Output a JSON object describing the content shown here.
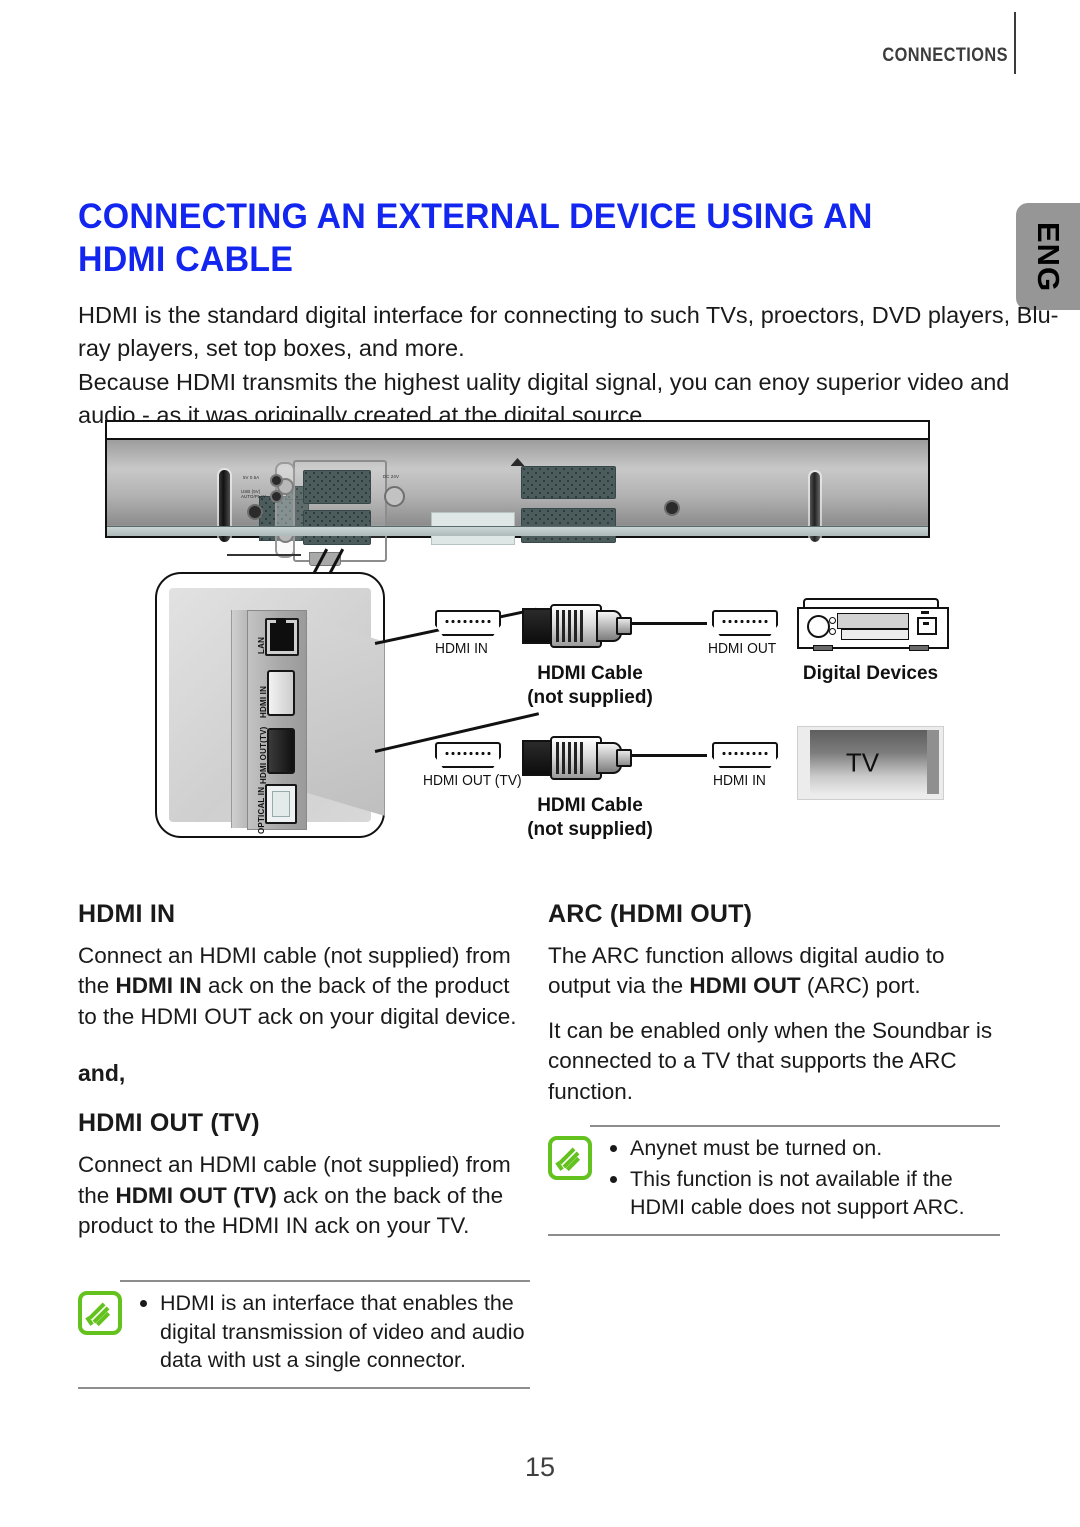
{
  "running_head": "CONNECTIONS",
  "side_tab": "ENG",
  "title": "CONNECTING AN EXTERNAL DEVICE USING AN HDMI CABLE",
  "intro": {
    "p1": "HDMI is the standard digital interface for connecting to such TVs, proectors, DVD players, Blu-ray players, set top boxes, and more.",
    "p2": "Because HDMI transmits the highest uality digital signal, you can enoy superior video and audio - as it was originally created at the digital source."
  },
  "figure": {
    "detail_panel": {
      "ports": [
        {
          "label": "LAN",
          "name": "lan-port"
        },
        {
          "label": "HDMI IN",
          "name": "hdmi-in-port"
        },
        {
          "label": "HDMI OUT(TV)",
          "name": "hdmi-out-tv-port"
        },
        {
          "label": "OPTICAL IN",
          "name": "optical-in-port"
        }
      ]
    },
    "row1": {
      "left_port": "HDMI IN",
      "cable_label": "HDMI Cable",
      "cable_sub": "(not supplied)",
      "right_port": "HDMI OUT",
      "device_label": "Digital Devices"
    },
    "row2": {
      "left_port": "HDMI OUT (TV)",
      "cable_label": "HDMI Cable",
      "cable_sub": "(not supplied)",
      "right_port": "HDMI IN",
      "device_label": "TV"
    }
  },
  "left_column": {
    "heading1": "HDMI IN",
    "para1_a": "Connect an HDMI cable (not supplied) from the ",
    "para1_b": "HDMI IN",
    "para1_c": " ack on the back of the product to the HDMI OUT ack on your digital device.",
    "and": "and,",
    "heading2": "HDMI OUT (TV)",
    "para2_a": "Connect an HDMI cable (not supplied) from the ",
    "para2_b": "HDMI OUT (TV)",
    "para2_c": " ack on the back of the product to the HDMI IN ack on your TV."
  },
  "right_column": {
    "heading1": "ARC (HDMI OUT)",
    "para1_a": "The ARC function allows digital audio to output via the ",
    "para1_b": "HDMI OUT",
    "para1_c": " (ARC) port.",
    "para2": "It can be enabled only when the Soundbar is connected to a TV that supports the ARC function."
  },
  "note_left": {
    "icon": "note-pencil-icon",
    "items": [
      "HDMI is an interface that enables the digital transmission of video and audio data with ust a single connector."
    ]
  },
  "note_right": {
    "icon": "note-pencil-icon",
    "items": [
      "Anynet must be turned on.",
      "This function is not available if the HDMI cable does not support ARC."
    ]
  },
  "page_number": "15",
  "colors": {
    "title_blue": "#1226f0",
    "note_green": "#63c21d",
    "tab_gray": "#969696"
  }
}
